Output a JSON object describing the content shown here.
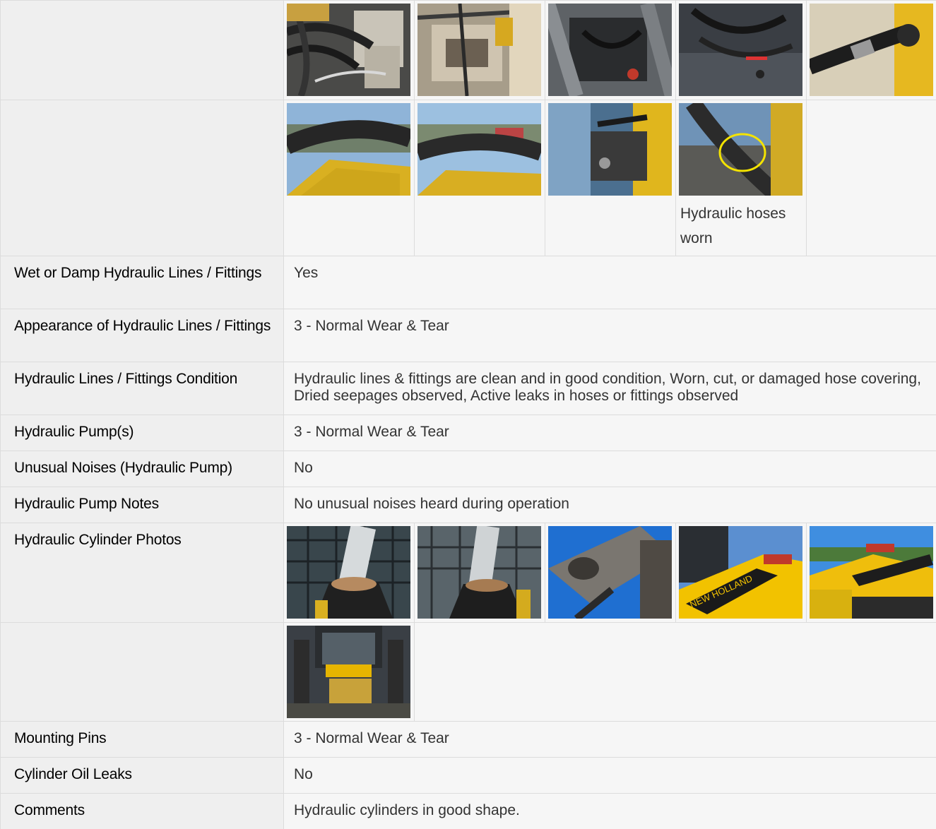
{
  "top_photos": {
    "row1": [
      "",
      "",
      "",
      "",
      ""
    ],
    "row2": [
      "",
      "",
      "",
      "Hydraulic hoses worn"
    ]
  },
  "fields": [
    {
      "label": "Wet or Damp Hydraulic Lines / Fittings",
      "value": "Yes"
    },
    {
      "label": "Appearance of Hydraulic Lines / Fittings",
      "value": "3 - Normal Wear & Tear"
    },
    {
      "label": "Hydraulic Lines / Fittings Condition",
      "value": "Hydraulic lines & fittings are clean and in good condition, Worn, cut, or damaged hose covering, Dried seepages observed, Active leaks in hoses or fittings observed"
    },
    {
      "label": "Hydraulic Pump(s)",
      "value": "3 - Normal Wear & Tear"
    },
    {
      "label": "Unusual Noises (Hydraulic Pump)",
      "value": "No"
    },
    {
      "label": "Hydraulic Pump Notes",
      "value": "No unusual noises heard during operation"
    }
  ],
  "cylinder_photos": {
    "label": "Hydraulic Cylinder Photos"
  },
  "fields2": [
    {
      "label": "Mounting Pins",
      "value": "3 - Normal Wear & Tear"
    },
    {
      "label": "Cylinder Oil Leaks",
      "value": "No"
    },
    {
      "label": "Comments",
      "value": "Hydraulic cylinders in good shape."
    }
  ],
  "colors": {
    "label_bg": "#efefef",
    "value_bg": "#f6f6f6",
    "border": "#dcdcdc",
    "machine_yellow": "#f2c200"
  }
}
